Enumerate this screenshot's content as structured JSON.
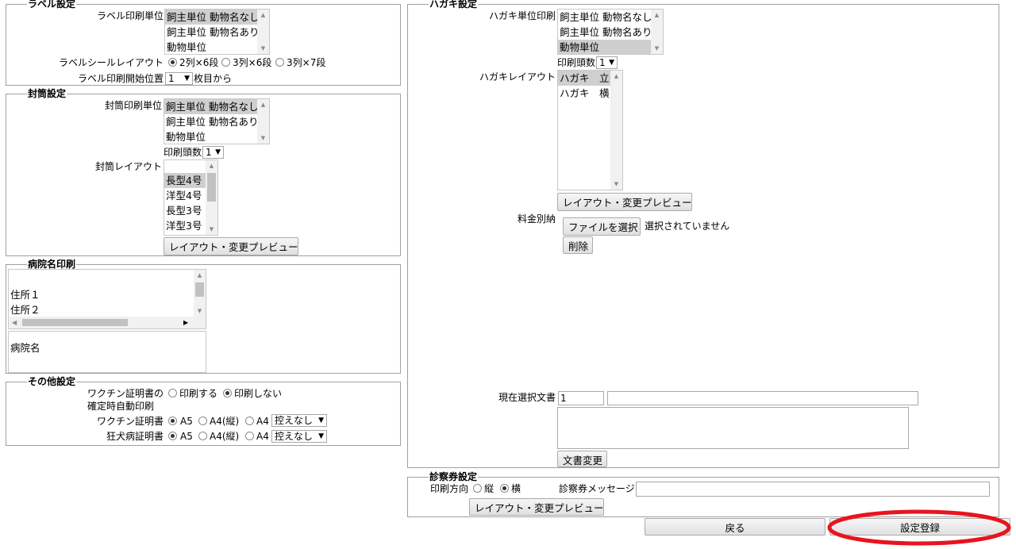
{
  "label": {
    "legend": "ラベル設定",
    "unit_label": "ラベル印刷単位",
    "unit_options": [
      "飼主単位 動物名なし",
      "飼主単位 動物名あり",
      "動物単位"
    ],
    "layout_label": "ラベルシールレイアウト",
    "layout_options": [
      "2列×6段",
      "3列×6段",
      "3列×7段"
    ],
    "start_label": "ラベル印刷開始位置",
    "start_value": "1",
    "start_suffix": "枚目から"
  },
  "envelope": {
    "legend": "封筒設定",
    "unit_label": "封筒印刷単位",
    "unit_options": [
      "飼主単位 動物名なし",
      "飼主単位 動物名あり",
      "動物単位"
    ],
    "copies_label": "印刷頭数",
    "copies_value": "1",
    "layout_label": "封筒レイアウト",
    "layout_options": [
      "",
      "長型4号",
      "洋型4号",
      "長型3号",
      "洋型3号"
    ],
    "preview_button": "レイアウト・変更プレビュー"
  },
  "hospital": {
    "legend": "病院名印刷",
    "address_items": [
      "住所１",
      "住所２"
    ],
    "hospital_name": "病院名"
  },
  "other": {
    "legend": "その他設定",
    "vaccine_auto_label_1": "ワクチン証明書の",
    "vaccine_auto_label_2": "確定時自動印刷",
    "print_yes": "印刷する",
    "print_no": "印刷しない",
    "vaccine_cert_label": "ワクチン証明書",
    "rabies_cert_label": "狂犬病証明書",
    "size_a5": "A5",
    "size_a4v": "A4(縦)",
    "size_a4": "A4",
    "margin_value": "控えなし"
  },
  "postcard": {
    "legend": "ハガキ設定",
    "unit_label": "ハガキ単位印刷",
    "unit_options": [
      "飼主単位 動物名なし",
      "飼主単位 動物名あり",
      "動物単位"
    ],
    "copies_label": "印刷頭数",
    "copies_value": "1",
    "layout_label": "ハガキレイアウト",
    "layout_options": [
      "ハガキ　立",
      "ハガキ　横"
    ],
    "preview_button": "レイアウト・変更プレビュー",
    "postage_label": "料金別納",
    "file_button": "ファイルを選択",
    "file_status": "選択されていません",
    "delete_button": "削除",
    "current_doc_label": "現在選択文書",
    "current_doc_no": "1",
    "doc_change_button": "文書変更"
  },
  "ticket": {
    "legend": "診察券設定",
    "direction_label": "印刷方向",
    "vertical": "縦",
    "horizontal": "横",
    "message_label": "診察券メッセージ",
    "preview_button": "レイアウト・変更プレビュー"
  },
  "footer": {
    "back_button": "戻る",
    "save_button": "設定登録"
  },
  "colors": {
    "highlight_ellipse": "#e8141e",
    "selected_item": "#cfcfcf"
  }
}
